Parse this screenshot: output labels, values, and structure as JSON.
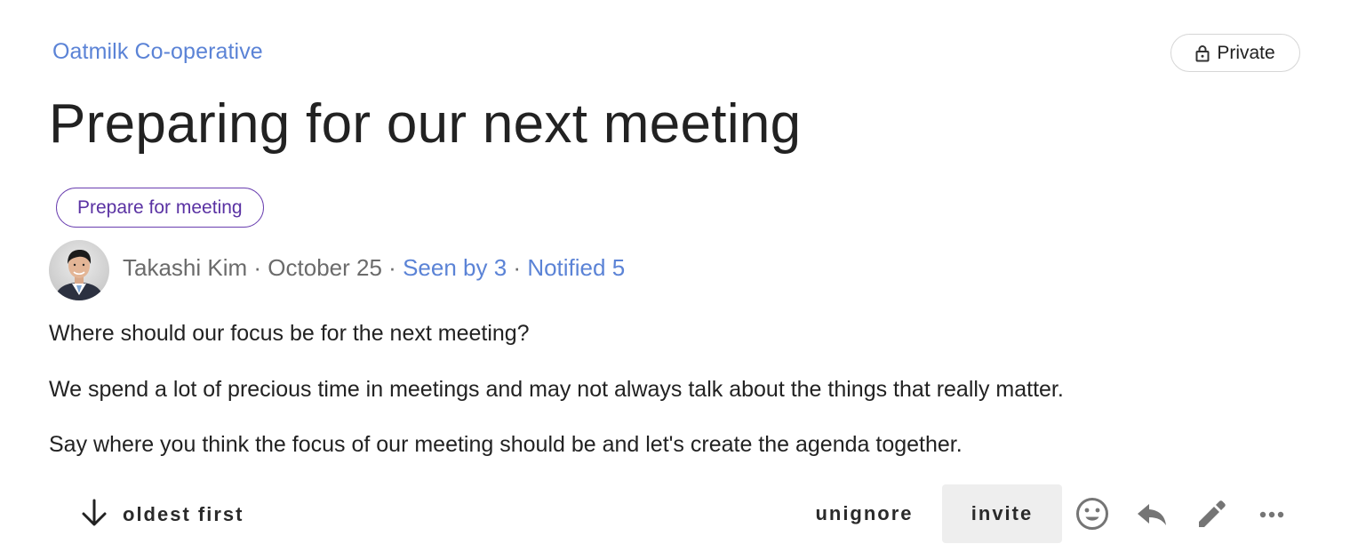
{
  "group": {
    "name": "Oatmilk Co-operative"
  },
  "privacy": {
    "label": "Private",
    "icon": "lock-icon"
  },
  "discussion": {
    "title": "Preparing for our next meeting",
    "tag": "Prepare for meeting",
    "author": "Takashi Kim",
    "separator": "·",
    "date": "October 25",
    "seen_by": "Seen by 3",
    "notified": "Notified 5",
    "body": [
      "Where should our focus be for the next meeting?",
      "We spend a lot of precious time in meetings and may not always talk about the things that really matter.",
      "Say where you think the focus of our meeting should be and let's create the agenda together."
    ]
  },
  "actions": {
    "order_label": "oldest first",
    "order_icon": "arrow-down-icon",
    "unignore_label": "unignore",
    "invite_label": "invite",
    "icons": [
      "emoji-icon",
      "reply-icon",
      "edit-icon",
      "more-icon"
    ]
  },
  "colors": {
    "link": "#5b83d6",
    "tag_border": "#6a3fb0",
    "tag_text": "#5a32a3",
    "text": "#222222",
    "muted": "#6b6b6b",
    "invite_bg": "#eeeeee",
    "icon": "#757575"
  }
}
